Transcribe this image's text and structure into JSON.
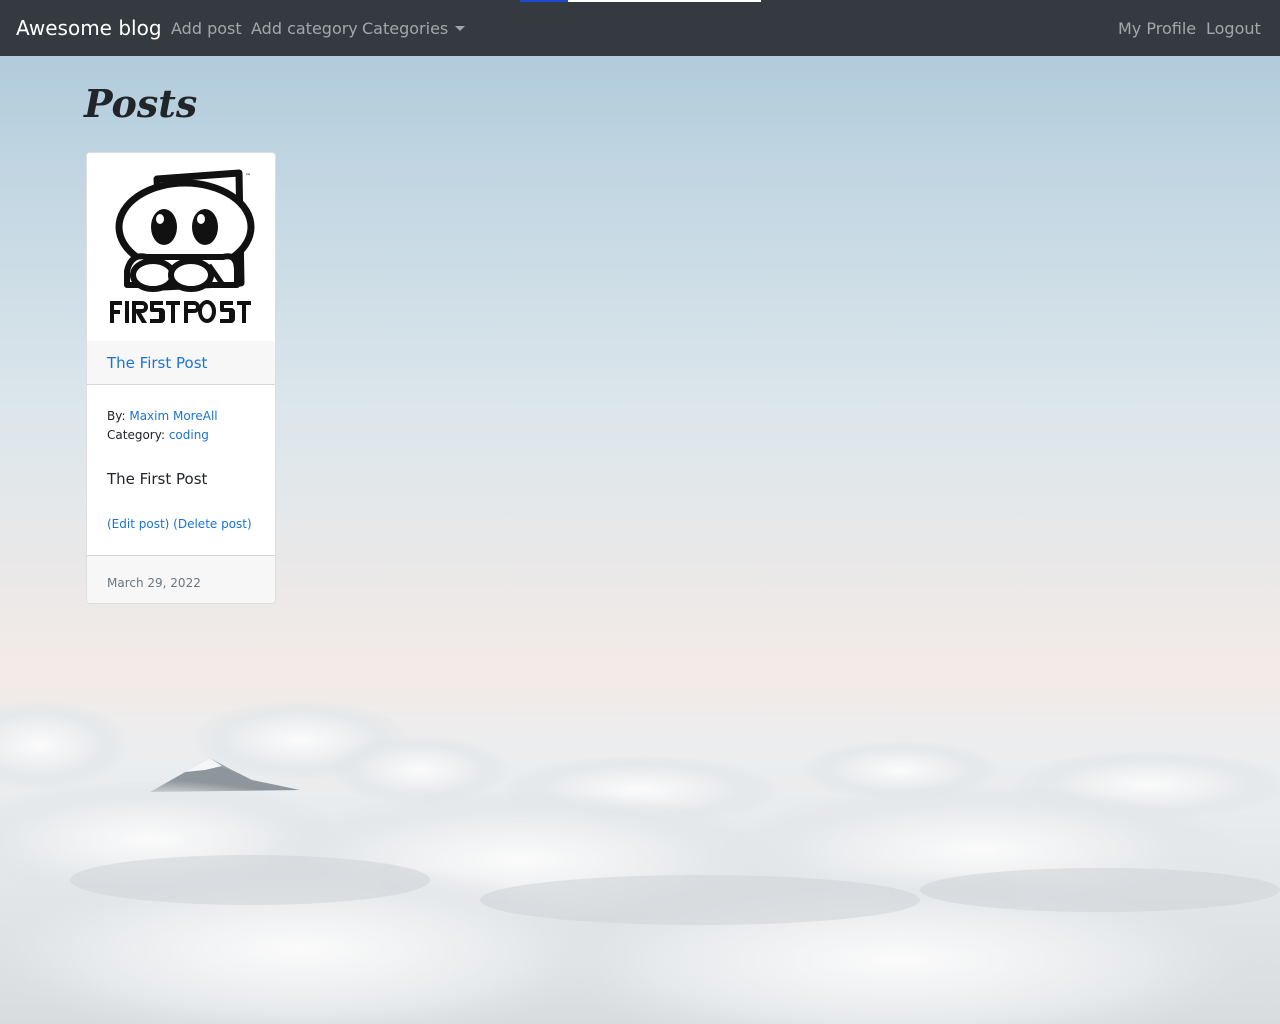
{
  "navbar": {
    "brand": "Awesome blog",
    "links": [
      "Add post",
      "Add category",
      "Categories"
    ],
    "right_links": [
      "My Profile",
      "Logout"
    ],
    "loading_progress": 0.2
  },
  "page": {
    "title": "Posts"
  },
  "posts": [
    {
      "image_logo_text": "FIRST POST",
      "title": "The First Post",
      "author_label": "By:",
      "author": "Maxim MoreAll",
      "category_label": "Category:",
      "category": "coding",
      "body": "The First Post",
      "edit_label": "(Edit post)",
      "delete_label": "(Delete post)",
      "date": "March 29, 2022"
    }
  ],
  "colors": {
    "navbar": "#343a40",
    "link": "#1a73d9",
    "progress": "#1a4bd0"
  }
}
